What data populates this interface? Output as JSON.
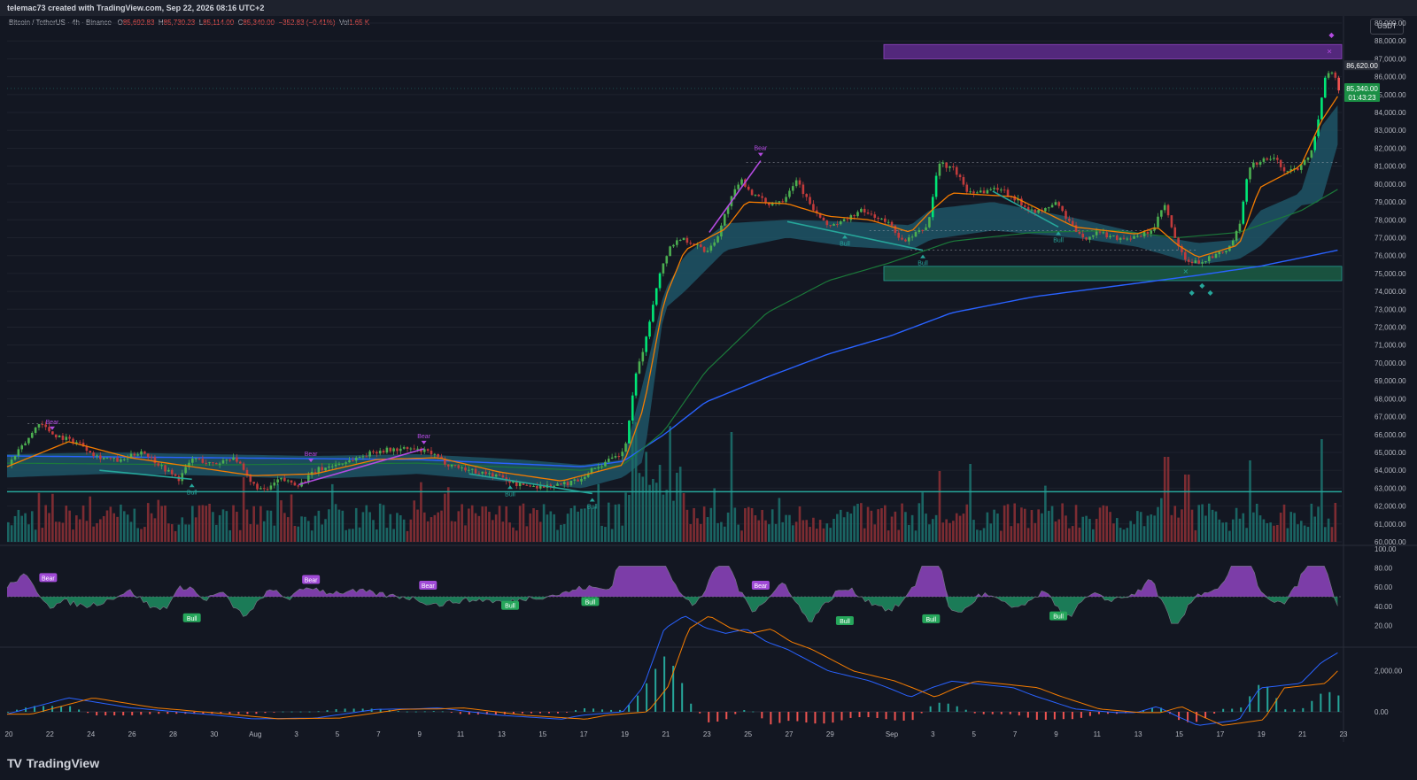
{
  "header": {
    "author_line": "telemac73 created with TradingView.com, Sep 22, 2026 08:16 UTC+2"
  },
  "symbol": {
    "name": "Bitcoin / TetherUS · 4h · Binance",
    "open_label": "O",
    "open": "85,692.83",
    "high_label": "H",
    "high": "85,730.23",
    "low_label": "L",
    "low": "85,114.00",
    "close_label": "C",
    "close": "85,340.00",
    "change": "−352.83 (−0.41%)",
    "vol_label": "Vol",
    "vol": "1.65 K"
  },
  "currency_button": "USDT",
  "brand": {
    "name": "TradingView",
    "mark": "TV"
  },
  "colors": {
    "background": "#131722",
    "grid": "#1e222d",
    "up": "#26a69a",
    "down": "#ef5350",
    "bright_up": "#00e676",
    "ema_fast": "#f57c00",
    "ema_mid": "#1b7a3a",
    "ema_slow": "#2962ff",
    "cloud": "#1f5566",
    "bear": "#b44be1",
    "bull": "#26a69a",
    "support": "#26a69a"
  },
  "price_tags": {
    "last_price": "85,340.00",
    "countdown": "01:43:23",
    "marked_level": "86,620.00"
  },
  "chart_data": {
    "type": "candlestick",
    "main": {
      "y_ticks": [
        "89,000.00",
        "88,000.00",
        "87,000.00",
        "86,000.00",
        "85,000.00",
        "84,000.00",
        "83,000.00",
        "82,000.00",
        "81,000.00",
        "80,000.00",
        "79,000.00",
        "78,000.00",
        "77,000.00",
        "76,000.00",
        "75,000.00",
        "74,000.00",
        "73,000.00",
        "72,000.00",
        "71,000.00",
        "70,000.00",
        "69,000.00",
        "68,000.00",
        "67,000.00",
        "66,000.00",
        "65,000.00",
        "64,000.00",
        "63,000.00",
        "62,000.00",
        "61,000.00",
        "60,000.00"
      ],
      "ylim": [
        60000,
        89000
      ],
      "price_path": [
        {
          "d": 0,
          "p": 64300
        },
        {
          "d": 1,
          "p": 65800
        },
        {
          "d": 1.5,
          "p": 66700
        },
        {
          "d": 2.2,
          "p": 66000
        },
        {
          "d": 3.5,
          "p": 65500
        },
        {
          "d": 4.3,
          "p": 64800
        },
        {
          "d": 5.5,
          "p": 64500
        },
        {
          "d": 6.5,
          "p": 65100
        },
        {
          "d": 7.6,
          "p": 64100
        },
        {
          "d": 8.3,
          "p": 63500
        },
        {
          "d": 9,
          "p": 64700
        },
        {
          "d": 10,
          "p": 64300
        },
        {
          "d": 11,
          "p": 64800
        },
        {
          "d": 11.8,
          "p": 63300
        },
        {
          "d": 12.5,
          "p": 62800
        },
        {
          "d": 13.2,
          "p": 63500
        },
        {
          "d": 14.2,
          "p": 63200
        },
        {
          "d": 15,
          "p": 64000
        },
        {
          "d": 16.5,
          "p": 64500
        },
        {
          "d": 18,
          "p": 65100
        },
        {
          "d": 19.5,
          "p": 65200
        },
        {
          "d": 20.5,
          "p": 65000
        },
        {
          "d": 21.3,
          "p": 64400
        },
        {
          "d": 22.5,
          "p": 64000
        },
        {
          "d": 23.8,
          "p": 63700
        },
        {
          "d": 24.8,
          "p": 63200
        },
        {
          "d": 26,
          "p": 63100
        },
        {
          "d": 27,
          "p": 63200
        },
        {
          "d": 27.8,
          "p": 63500
        },
        {
          "d": 28.5,
          "p": 64100
        },
        {
          "d": 29.2,
          "p": 64500
        },
        {
          "d": 30,
          "p": 65000
        },
        {
          "d": 30.6,
          "p": 69500
        },
        {
          "d": 31.1,
          "p": 71500
        },
        {
          "d": 31.6,
          "p": 74500
        },
        {
          "d": 32.2,
          "p": 76500
        },
        {
          "d": 32.8,
          "p": 77000
        },
        {
          "d": 33.5,
          "p": 76600
        },
        {
          "d": 34,
          "p": 76200
        },
        {
          "d": 34.6,
          "p": 77200
        },
        {
          "d": 35.1,
          "p": 79000
        },
        {
          "d": 35.7,
          "p": 80200
        },
        {
          "d": 36.3,
          "p": 79400
        },
        {
          "d": 37,
          "p": 78900
        },
        {
          "d": 37.7,
          "p": 79100
        },
        {
          "d": 38.4,
          "p": 80300
        },
        {
          "d": 39,
          "p": 78900
        },
        {
          "d": 39.8,
          "p": 77700
        },
        {
          "d": 40.5,
          "p": 77800
        },
        {
          "d": 41.5,
          "p": 78500
        },
        {
          "d": 42.2,
          "p": 78200
        },
        {
          "d": 43,
          "p": 77700
        },
        {
          "d": 43.6,
          "p": 76700
        },
        {
          "d": 44.2,
          "p": 77200
        },
        {
          "d": 44.8,
          "p": 77700
        },
        {
          "d": 45.3,
          "p": 81200
        },
        {
          "d": 46.1,
          "p": 80800
        },
        {
          "d": 46.7,
          "p": 79600
        },
        {
          "d": 47.5,
          "p": 79600
        },
        {
          "d": 48.3,
          "p": 79800
        },
        {
          "d": 49,
          "p": 79200
        },
        {
          "d": 49.6,
          "p": 78700
        },
        {
          "d": 50.3,
          "p": 78400
        },
        {
          "d": 51,
          "p": 79000
        },
        {
          "d": 51.6,
          "p": 78000
        },
        {
          "d": 52.3,
          "p": 76900
        },
        {
          "d": 53,
          "p": 77300
        },
        {
          "d": 54,
          "p": 77000
        },
        {
          "d": 55,
          "p": 77000
        },
        {
          "d": 55.8,
          "p": 77500
        },
        {
          "d": 56.3,
          "p": 78900
        },
        {
          "d": 56.8,
          "p": 77000
        },
        {
          "d": 57.3,
          "p": 75700
        },
        {
          "d": 57.9,
          "p": 75600
        },
        {
          "d": 58.6,
          "p": 75900
        },
        {
          "d": 59.4,
          "p": 76300
        },
        {
          "d": 60,
          "p": 77700
        },
        {
          "d": 60.4,
          "p": 81000
        },
        {
          "d": 61,
          "p": 81300
        },
        {
          "d": 61.6,
          "p": 81500
        },
        {
          "d": 62.2,
          "p": 80700
        },
        {
          "d": 62.8,
          "p": 80900
        },
        {
          "d": 63.4,
          "p": 81700
        },
        {
          "d": 63.8,
          "p": 83500
        },
        {
          "d": 64.1,
          "p": 86000
        },
        {
          "d": 64.4,
          "p": 86500
        },
        {
          "d": 64.8,
          "p": 85340
        }
      ],
      "ema_fast": [
        [
          0,
          64200
        ],
        [
          3,
          65600
        ],
        [
          6,
          64700
        ],
        [
          9,
          64200
        ],
        [
          12,
          63700
        ],
        [
          15,
          63800
        ],
        [
          18,
          64600
        ],
        [
          21,
          64700
        ],
        [
          24,
          63900
        ],
        [
          27,
          63400
        ],
        [
          30,
          64300
        ],
        [
          31,
          67500
        ],
        [
          32,
          73500
        ],
        [
          33,
          76300
        ],
        [
          35,
          77500
        ],
        [
          36,
          79000
        ],
        [
          38,
          78900
        ],
        [
          40,
          78200
        ],
        [
          42,
          78000
        ],
        [
          44,
          77300
        ],
        [
          45,
          78500
        ],
        [
          46,
          79500
        ],
        [
          49,
          79300
        ],
        [
          52,
          77600
        ],
        [
          55,
          77200
        ],
        [
          56,
          77600
        ],
        [
          57,
          76600
        ],
        [
          58,
          75900
        ],
        [
          60,
          76600
        ],
        [
          61,
          79800
        ],
        [
          63,
          81000
        ],
        [
          64,
          83500
        ],
        [
          64.8,
          84900
        ]
      ],
      "ema_mid": [
        [
          0,
          64400
        ],
        [
          10,
          64300
        ],
        [
          20,
          64400
        ],
        [
          28,
          64000
        ],
        [
          30,
          64300
        ],
        [
          32,
          66200
        ],
        [
          34,
          69500
        ],
        [
          37,
          72800
        ],
        [
          40,
          74600
        ],
        [
          43,
          75600
        ],
        [
          46,
          76800
        ],
        [
          50,
          77300
        ],
        [
          54,
          77400
        ],
        [
          57,
          77000
        ],
        [
          60,
          77300
        ],
        [
          63,
          78500
        ],
        [
          64.8,
          79700
        ]
      ],
      "ema_slow": [
        [
          0,
          64800
        ],
        [
          10,
          64700
        ],
        [
          20,
          64600
        ],
        [
          28,
          64200
        ],
        [
          30,
          64500
        ],
        [
          32,
          66000
        ],
        [
          34,
          67800
        ],
        [
          37,
          69200
        ],
        [
          40,
          70500
        ],
        [
          43,
          71500
        ],
        [
          46,
          72800
        ],
        [
          50,
          73700
        ],
        [
          54,
          74300
        ],
        [
          58,
          74900
        ],
        [
          61,
          75400
        ],
        [
          64.8,
          76300
        ]
      ],
      "cloud_top": [
        [
          0,
          64900
        ],
        [
          5,
          65000
        ],
        [
          10,
          64900
        ],
        [
          15,
          64800
        ],
        [
          20,
          64900
        ],
        [
          25,
          64600
        ],
        [
          28,
          64300
        ],
        [
          30,
          64600
        ],
        [
          31,
          69000
        ],
        [
          32,
          74000
        ],
        [
          33,
          76000
        ],
        [
          35,
          77800
        ],
        [
          38,
          78000
        ],
        [
          41,
          77900
        ],
        [
          44,
          77700
        ],
        [
          45,
          78600
        ],
        [
          48,
          79000
        ],
        [
          52,
          78100
        ],
        [
          55,
          77300
        ],
        [
          58,
          76700
        ],
        [
          60,
          76900
        ],
        [
          61,
          78500
        ],
        [
          63,
          79500
        ],
        [
          64,
          83200
        ],
        [
          64.8,
          84400
        ]
      ],
      "cloud_bottom": [
        [
          0,
          63600
        ],
        [
          5,
          63800
        ],
        [
          10,
          63700
        ],
        [
          15,
          63500
        ],
        [
          20,
          63800
        ],
        [
          25,
          63300
        ],
        [
          28,
          63000
        ],
        [
          30,
          63600
        ],
        [
          31,
          64500
        ],
        [
          32,
          73000
        ],
        [
          33,
          74000
        ],
        [
          35,
          76300
        ],
        [
          38,
          77000
        ],
        [
          41,
          76500
        ],
        [
          44,
          76300
        ],
        [
          45,
          76900
        ],
        [
          48,
          77400
        ],
        [
          52,
          77000
        ],
        [
          55,
          76500
        ],
        [
          58,
          75500
        ],
        [
          60,
          75800
        ],
        [
          61,
          76500
        ],
        [
          63,
          78800
        ],
        [
          64,
          79000
        ],
        [
          64.8,
          82200
        ]
      ],
      "volume": [
        {
          "d": 30.5,
          "v": 2.3
        },
        {
          "d": 31.7,
          "v": 1.5
        },
        {
          "d": 32.2,
          "v": 2.1
        },
        {
          "d": 35.2,
          "v": 3.1
        },
        {
          "d": 45.3,
          "v": 2.0
        },
        {
          "d": 46.8,
          "v": 2.2
        },
        {
          "d": 56.4,
          "v": 2.4
        },
        {
          "d": 57.4,
          "v": 1.9
        },
        {
          "d": 60.5,
          "v": 2.3
        },
        {
          "d": 64.0,
          "v": 2.9
        },
        {
          "d": 64.6,
          "v": 1.1
        }
      ],
      "support_line": 62800,
      "supply_zone": [
        87000,
        87800
      ],
      "demand_zone": [
        74600,
        75400
      ],
      "dotted_levels": [
        {
          "y": 66600,
          "x0": 1,
          "x1": 30
        },
        {
          "y": 81200,
          "x0": 36,
          "x1": 64.8
        },
        {
          "y": 76300,
          "x0": 44,
          "x1": 58
        },
        {
          "y": 77400,
          "x0": 42,
          "x1": 56
        }
      ],
      "divergences": [
        {
          "kind": "Bear",
          "from": [
            34.2,
            77300
          ],
          "to": [
            36.7,
            81300
          ],
          "label_at": [
            36.7,
            81300
          ]
        },
        {
          "kind": "Bear",
          "from": [
            14.2,
            63200
          ],
          "to": [
            20.3,
            65200
          ],
          "label_at": [
            20.3,
            65200
          ]
        },
        {
          "kind": "Bear",
          "from": null,
          "to": null,
          "label_at": [
            2.2,
            66000
          ]
        },
        {
          "kind": "Bear",
          "from": null,
          "to": null,
          "label_at": [
            14.8,
            64200
          ]
        },
        {
          "kind": "Bull",
          "from": [
            4.5,
            64000
          ],
          "to": [
            9,
            63500
          ],
          "label_at": [
            9,
            63500
          ]
        },
        {
          "kind": "Bull",
          "from": [
            22.5,
            63800
          ],
          "to": [
            28.5,
            62700
          ],
          "label_at": [
            28.5,
            62700
          ]
        },
        {
          "kind": "Bull",
          "from": null,
          "to": null,
          "label_at": [
            24.5,
            63400
          ]
        },
        {
          "kind": "Bull",
          "from": [
            38,
            77900
          ],
          "to": [
            44.6,
            76300
          ],
          "label_at": [
            44.6,
            76300
          ]
        },
        {
          "kind": "Bull",
          "from": [
            48,
            79600
          ],
          "to": [
            51.2,
            77600
          ],
          "label_at": [
            51.2,
            77600
          ]
        },
        {
          "kind": "Bull",
          "from": null,
          "to": null,
          "label_at": [
            40.8,
            77400
          ]
        }
      ]
    },
    "rsi": {
      "y_ticks": [
        "100.00",
        "80.00",
        "60.00",
        "40.00",
        "20.00"
      ],
      "ylim": [
        0,
        100
      ],
      "midline": 50,
      "labels": [
        {
          "kind": "Bear",
          "d": 2,
          "v": 70
        },
        {
          "kind": "Bear",
          "d": 14.8,
          "v": 68
        },
        {
          "kind": "Bear",
          "d": 20.5,
          "v": 62
        },
        {
          "kind": "Bear",
          "d": 36.7,
          "v": 62
        },
        {
          "kind": "Bull",
          "d": 9,
          "v": 28
        },
        {
          "kind": "Bull",
          "d": 24.5,
          "v": 41
        },
        {
          "kind": "Bull",
          "d": 28.4,
          "v": 45
        },
        {
          "kind": "Bull",
          "d": 40.8,
          "v": 25
        },
        {
          "kind": "Bull",
          "d": 45,
          "v": 27
        },
        {
          "kind": "Bull",
          "d": 51.2,
          "v": 30
        }
      ]
    },
    "macd": {
      "y_ticks": [
        "2,000.00",
        "0.00"
      ],
      "ylim": [
        -600,
        3000
      ]
    },
    "x_ticks": [
      {
        "label": "20",
        "d": 0
      },
      {
        "label": "22",
        "d": 2
      },
      {
        "label": "24",
        "d": 4
      },
      {
        "label": "26",
        "d": 6
      },
      {
        "label": "28",
        "d": 8
      },
      {
        "label": "30",
        "d": 10
      },
      {
        "label": "Aug",
        "d": 12
      },
      {
        "label": "3",
        "d": 14
      },
      {
        "label": "5",
        "d": 16
      },
      {
        "label": "7",
        "d": 18
      },
      {
        "label": "9",
        "d": 20
      },
      {
        "label": "11",
        "d": 22
      },
      {
        "label": "13",
        "d": 24
      },
      {
        "label": "15",
        "d": 26
      },
      {
        "label": "17",
        "d": 28
      },
      {
        "label": "19",
        "d": 30
      },
      {
        "label": "21",
        "d": 32
      },
      {
        "label": "23",
        "d": 34
      },
      {
        "label": "25",
        "d": 36
      },
      {
        "label": "27",
        "d": 38
      },
      {
        "label": "29",
        "d": 40
      },
      {
        "label": "Sep",
        "d": 43
      },
      {
        "label": "3",
        "d": 45
      },
      {
        "label": "5",
        "d": 47
      },
      {
        "label": "7",
        "d": 49
      },
      {
        "label": "9",
        "d": 51
      },
      {
        "label": "11",
        "d": 53
      },
      {
        "label": "13",
        "d": 55
      },
      {
        "label": "15",
        "d": 57
      },
      {
        "label": "17",
        "d": 59
      },
      {
        "label": "19",
        "d": 61
      },
      {
        "label": "21",
        "d": 63
      },
      {
        "label": "23",
        "d": 65
      }
    ]
  }
}
